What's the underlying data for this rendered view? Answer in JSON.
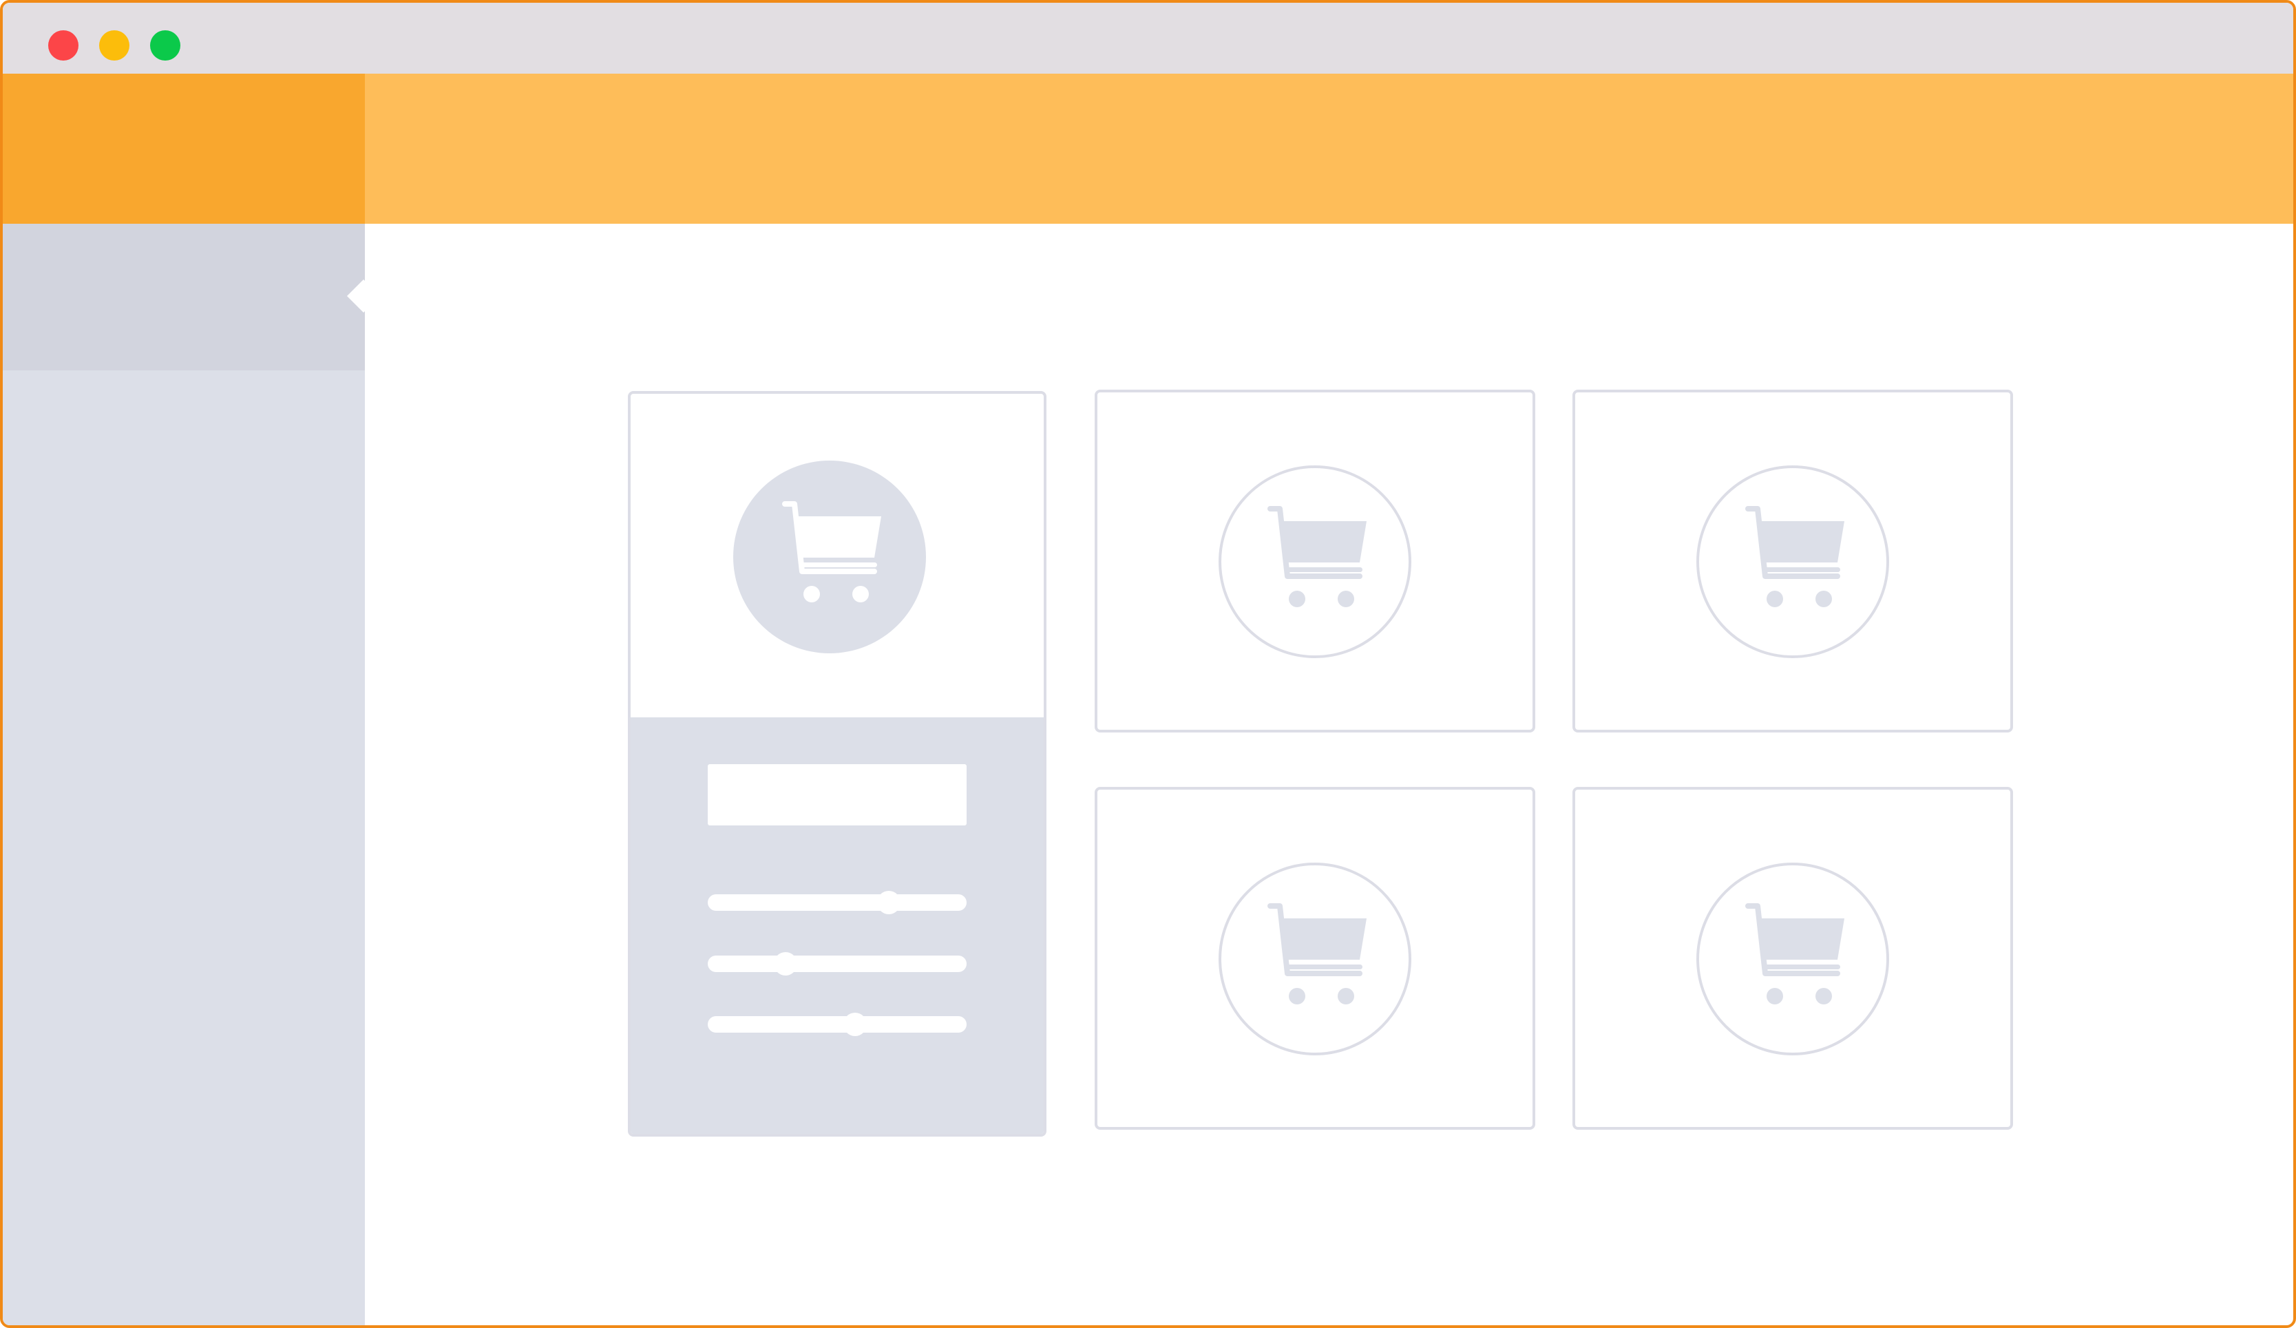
{
  "window": {
    "traffic_lights": [
      "close",
      "minimize",
      "zoom"
    ],
    "colors": {
      "close": "#fc4548",
      "minimize": "#fcbd0b",
      "zoom": "#0bc94a",
      "frame_border": "#f08a17",
      "header": "#febd59",
      "header_logo_block": "#f9a72e",
      "sidebar": "#dcdfe8",
      "sidebar_active": "#d2d4de",
      "card_border": "#dcdde6",
      "icon": "#dcdfe8"
    }
  },
  "sidebar": {
    "active_item_index": 0
  },
  "products": {
    "selected_index": 0,
    "items": [
      {
        "icon": "shopping-cart-icon",
        "selected": true
      },
      {
        "icon": "shopping-cart-icon",
        "selected": false
      },
      {
        "icon": "shopping-cart-icon",
        "selected": false
      },
      {
        "icon": "shopping-cart-icon",
        "selected": false
      },
      {
        "icon": "shopping-cart-icon",
        "selected": false
      }
    ]
  },
  "options_panel": {
    "sliders": [
      {
        "value": 0.7
      },
      {
        "value": 0.3
      },
      {
        "value": 0.57
      }
    ]
  }
}
